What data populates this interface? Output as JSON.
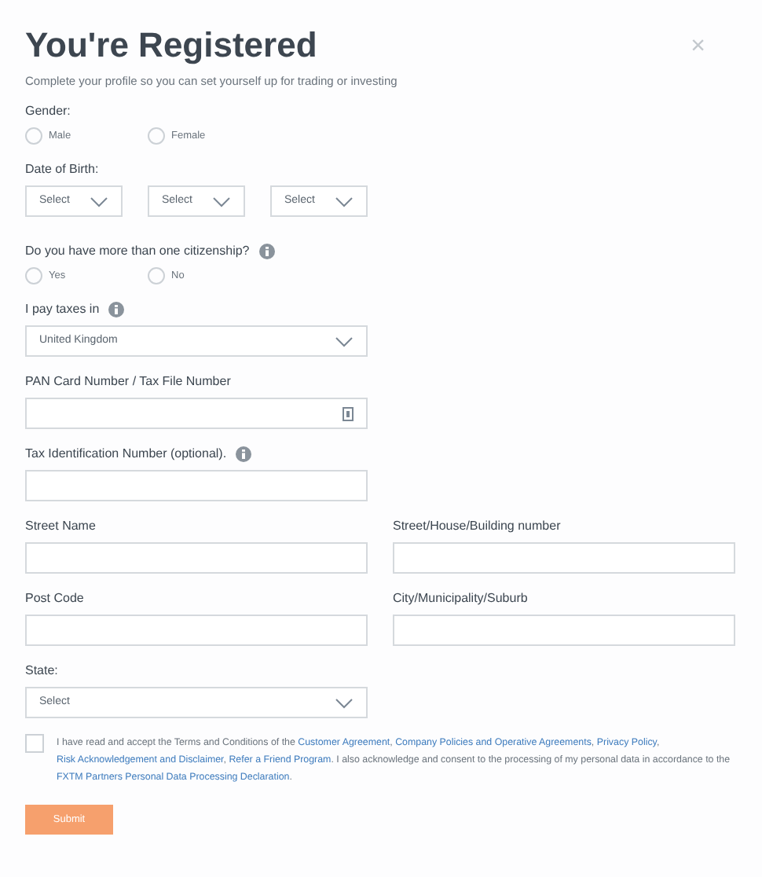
{
  "title": "You're Registered",
  "close": "×",
  "subtitle": "Complete your profile so you can set yourself up for trading or investing",
  "fields": [
    {
      "kind": "radio",
      "label": "Gender:",
      "options": [
        {
          "label": "Male",
          "selected": false
        },
        {
          "label": "Female",
          "selected": false
        }
      ]
    },
    {
      "kind": "triple_select",
      "label": "Date of Birth:",
      "selects": [
        "Select",
        "Select",
        "Select"
      ]
    },
    {
      "kind": "radio",
      "label": "Do you have more than one citizenship?",
      "info": true,
      "options": [
        {
          "label": "Yes",
          "selected": false
        },
        {
          "label": "No",
          "selected": false
        }
      ]
    },
    {
      "kind": "select",
      "label": "I pay taxes in",
      "info": true,
      "value": "United Kingdom"
    },
    {
      "kind": "input",
      "label": "PAN Card Number / Tax File Number",
      "card_icon": true
    },
    {
      "kind": "input",
      "label": "Tax Identification Number (optional).",
      "info": true
    },
    {
      "kind": "pair",
      "items": [
        {
          "label": "Street Name"
        },
        {
          "label": "Street/House/Building number"
        }
      ]
    },
    {
      "kind": "pair",
      "items": [
        {
          "label": "Post Code"
        },
        {
          "label": "City/Municipality/Suburb"
        }
      ]
    },
    {
      "kind": "select",
      "label": "State:",
      "value": "Select"
    }
  ],
  "consent": {
    "checked": false,
    "segments": [
      {
        "kind": "text",
        "text": "I have read and accept the Terms and Conditions of the "
      },
      {
        "kind": "link",
        "text": "Customer Agreement"
      },
      {
        "kind": "text",
        "text": ", "
      },
      {
        "kind": "link",
        "text": "Company Policies and Operative Agreements"
      },
      {
        "kind": "text",
        "text": ", "
      },
      {
        "kind": "link",
        "text": "Privacy Policy"
      },
      {
        "kind": "text",
        "text": ", "
      },
      {
        "kind": "link",
        "text": "Risk Acknowledgement and Disclaimer"
      },
      {
        "kind": "text",
        "text": ", "
      },
      {
        "kind": "link",
        "text": "Refer a Friend Program"
      },
      {
        "kind": "text",
        "text": ". I also acknowledge and consent to the processing of my personal data in accordance to the "
      },
      {
        "kind": "link",
        "text": "FXTM Partners Personal Data Processing Declaration"
      },
      {
        "kind": "text",
        "text": "."
      }
    ]
  },
  "submit": "Submit"
}
